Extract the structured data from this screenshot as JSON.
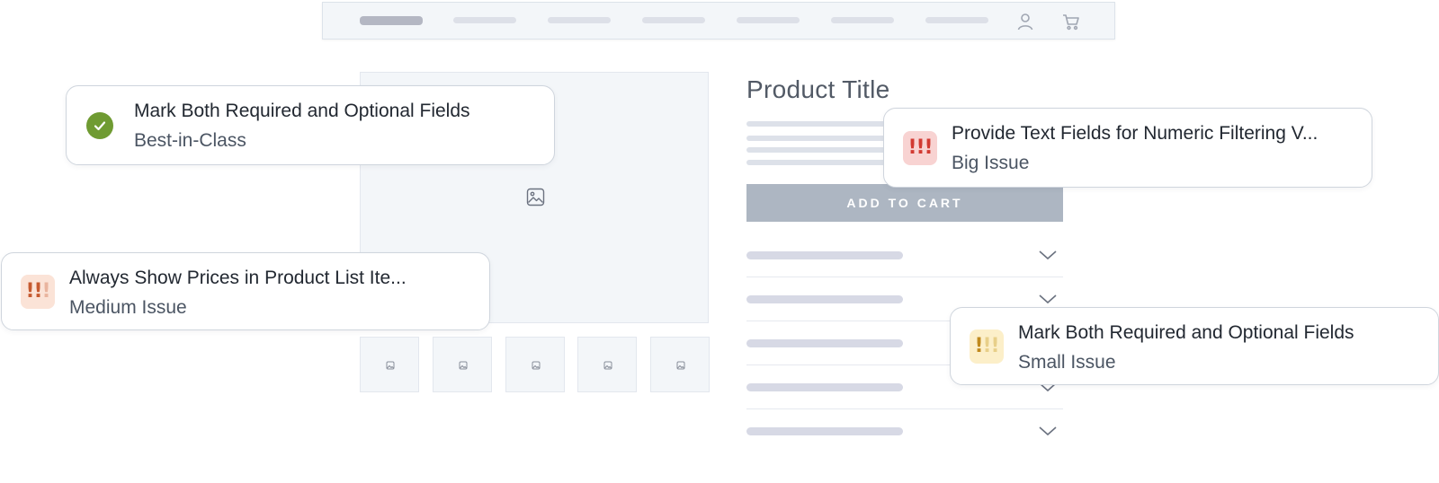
{
  "nav": {
    "icons": [
      "user-icon",
      "cart-icon"
    ]
  },
  "product": {
    "title": "Product Title",
    "cart_button_label": "ADD TO CART",
    "image_icon": "image-icon"
  },
  "callouts": [
    {
      "title": "Mark Both Required and Optional Fields",
      "rating": "Best-in-Class",
      "icon": "check-icon",
      "color": "#6f9b32"
    },
    {
      "title": "Provide Text Fields for Numeric Filtering V...",
      "rating": "Big Issue",
      "icon": "severity-high-icon",
      "color": "#d23a32"
    },
    {
      "title": "Always Show Prices in Product List Ite...",
      "rating": "Medium Issue",
      "icon": "severity-medium-icon",
      "color": "#c65a30"
    },
    {
      "title": "Mark Both Required and Optional Fields",
      "rating": "Small Issue",
      "icon": "severity-low-icon",
      "color": "#c08a1e"
    }
  ]
}
